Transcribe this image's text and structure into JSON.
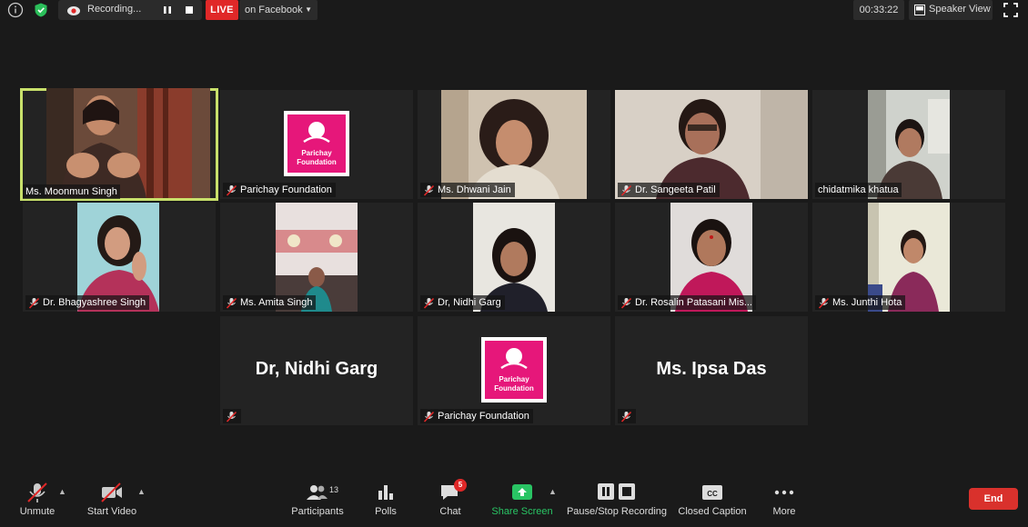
{
  "top_bar": {
    "info_icon": "info-icon",
    "security_icon": "shield-icon",
    "recording_label": "Recording...",
    "live_label": "LIVE",
    "live_destination": "on Facebook",
    "timer": "00:33:22",
    "view_label": "Speaker View",
    "colors": {
      "live": "#e02828",
      "security": "#2bbf5a"
    }
  },
  "gallery": {
    "participants": [
      {
        "name": "Ms. Moonmun Singh",
        "active_speaker": true,
        "muted": false
      },
      {
        "name": "Parichay Foundation",
        "muted": true,
        "logo": true
      },
      {
        "name": "Ms. Dhwani Jain",
        "muted": true
      },
      {
        "name": "Dr. Sangeeta Patil",
        "muted": true
      },
      {
        "name": "chidatmika khatua",
        "muted": false
      },
      {
        "name": "Dr. Bhagyashree Singh",
        "muted": true
      },
      {
        "name": "Ms. Amita Singh",
        "muted": true
      },
      {
        "name": "Dr, Nidhi Garg",
        "muted": true
      },
      {
        "name": "Dr. Rosalin Patasani Mis...",
        "muted": true
      },
      {
        "name": "Ms. Junthi Hota",
        "muted": true
      },
      {
        "name": "Dr, Nidhi Garg",
        "muted": true,
        "video_off": true
      },
      {
        "name": "Parichay Foundation",
        "muted": true,
        "logo": true
      },
      {
        "name": "Ms. Ipsa Das",
        "muted": true,
        "video_off": true
      }
    ],
    "logo_text": [
      "Parichay",
      "Foundation"
    ],
    "colors": {
      "active_border": "#c8e06b",
      "logo": "#e6177a"
    }
  },
  "toolbar": {
    "unmute_label": "Unmute",
    "video_label": "Start Video",
    "participants_label": "Participants",
    "participants_count": "13",
    "polls_label": "Polls",
    "chat_label": "Chat",
    "chat_badge": "5",
    "share_label": "Share Screen",
    "recording_label": "Pause/Stop Recording",
    "cc_label": "Closed Caption",
    "cc_icon_text": "CC",
    "more_label": "More",
    "end_label": "End",
    "colors": {
      "share": "#29c464",
      "end": "#d9312c"
    }
  }
}
